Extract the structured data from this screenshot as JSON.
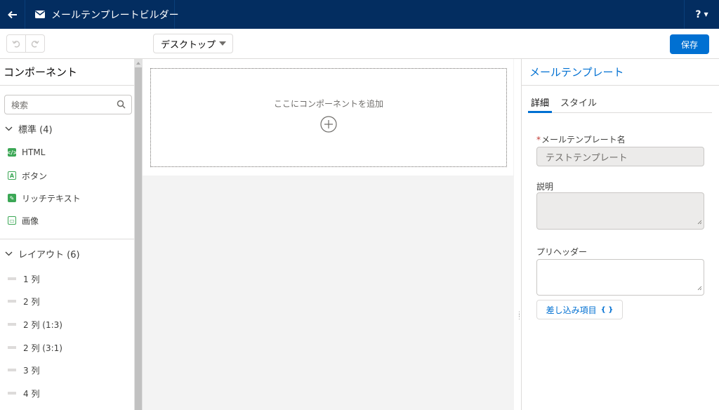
{
  "header": {
    "title": "メールテンプレートビルダー",
    "help_label": "?"
  },
  "toolbar": {
    "device_value": "デスクトップ",
    "save_label": "保存"
  },
  "left_panel": {
    "title": "コンポーネント",
    "search_placeholder": "検索",
    "standard_section": "標準 (4)",
    "standard_items": [
      "HTML",
      "ボタン",
      "リッチテキスト",
      "画像"
    ],
    "layout_section": "レイアウト (6)",
    "layout_items": [
      "1 列",
      "2 列",
      "2 列 (1:3)",
      "2 列 (3:1)",
      "3 列",
      "4 列"
    ]
  },
  "canvas": {
    "dropzone_text": "ここにコンポーネントを追加"
  },
  "right_panel": {
    "title": "メールテンプレート",
    "tabs": [
      "詳細",
      "スタイル"
    ],
    "active_tab": "詳細",
    "name_label": "メールテンプレート名",
    "name_value": "テストテンプレート",
    "description_label": "説明",
    "preheader_label": "プリヘッダー",
    "merge_button_label": "差し込み項目",
    "merge_button_suffix": "{ }"
  },
  "colors": {
    "header_bg": "#032d60",
    "brand_blue": "#0070d2",
    "component_green": "#3ba755"
  }
}
